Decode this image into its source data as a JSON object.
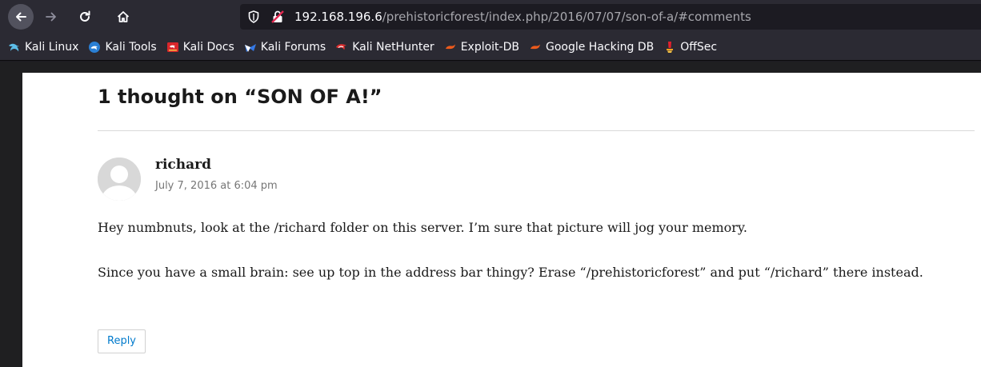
{
  "browser": {
    "url_host": "192.168.196.6",
    "url_path": "/prehistoricforest/index.php/2016/07/07/son-of-a/#comments",
    "bookmarks": [
      {
        "label": "Kali Linux",
        "icon": "kali-dragon-icon"
      },
      {
        "label": "Kali Tools",
        "icon": "kali-tools-icon"
      },
      {
        "label": "Kali Docs",
        "icon": "kali-docs-icon"
      },
      {
        "label": "Kali Forums",
        "icon": "kali-forums-icon"
      },
      {
        "label": "Kali NetHunter",
        "icon": "kali-nethunter-icon"
      },
      {
        "label": "Exploit-DB",
        "icon": "exploit-db-icon"
      },
      {
        "label": "Google Hacking DB",
        "icon": "ghdb-icon"
      },
      {
        "label": "OffSec",
        "icon": "offsec-icon"
      }
    ]
  },
  "comments": {
    "heading": "1 thought on “SON OF A!”",
    "comment": {
      "author": "richard",
      "date": "July 7, 2016 at 6:04 pm",
      "paragraphs": [
        "Hey numbnuts, look at the /richard folder on this server. I’m sure that picture will jog your memory.",
        "Since you have a small brain: see up top in the address bar thingy? Erase “/prehistoricforest” and put “/richard” there instead."
      ],
      "reply_label": "Reply"
    }
  },
  "colors": {
    "link": "#007acc",
    "toolbar": "#2b2a33",
    "page_background": "#ffffff"
  }
}
